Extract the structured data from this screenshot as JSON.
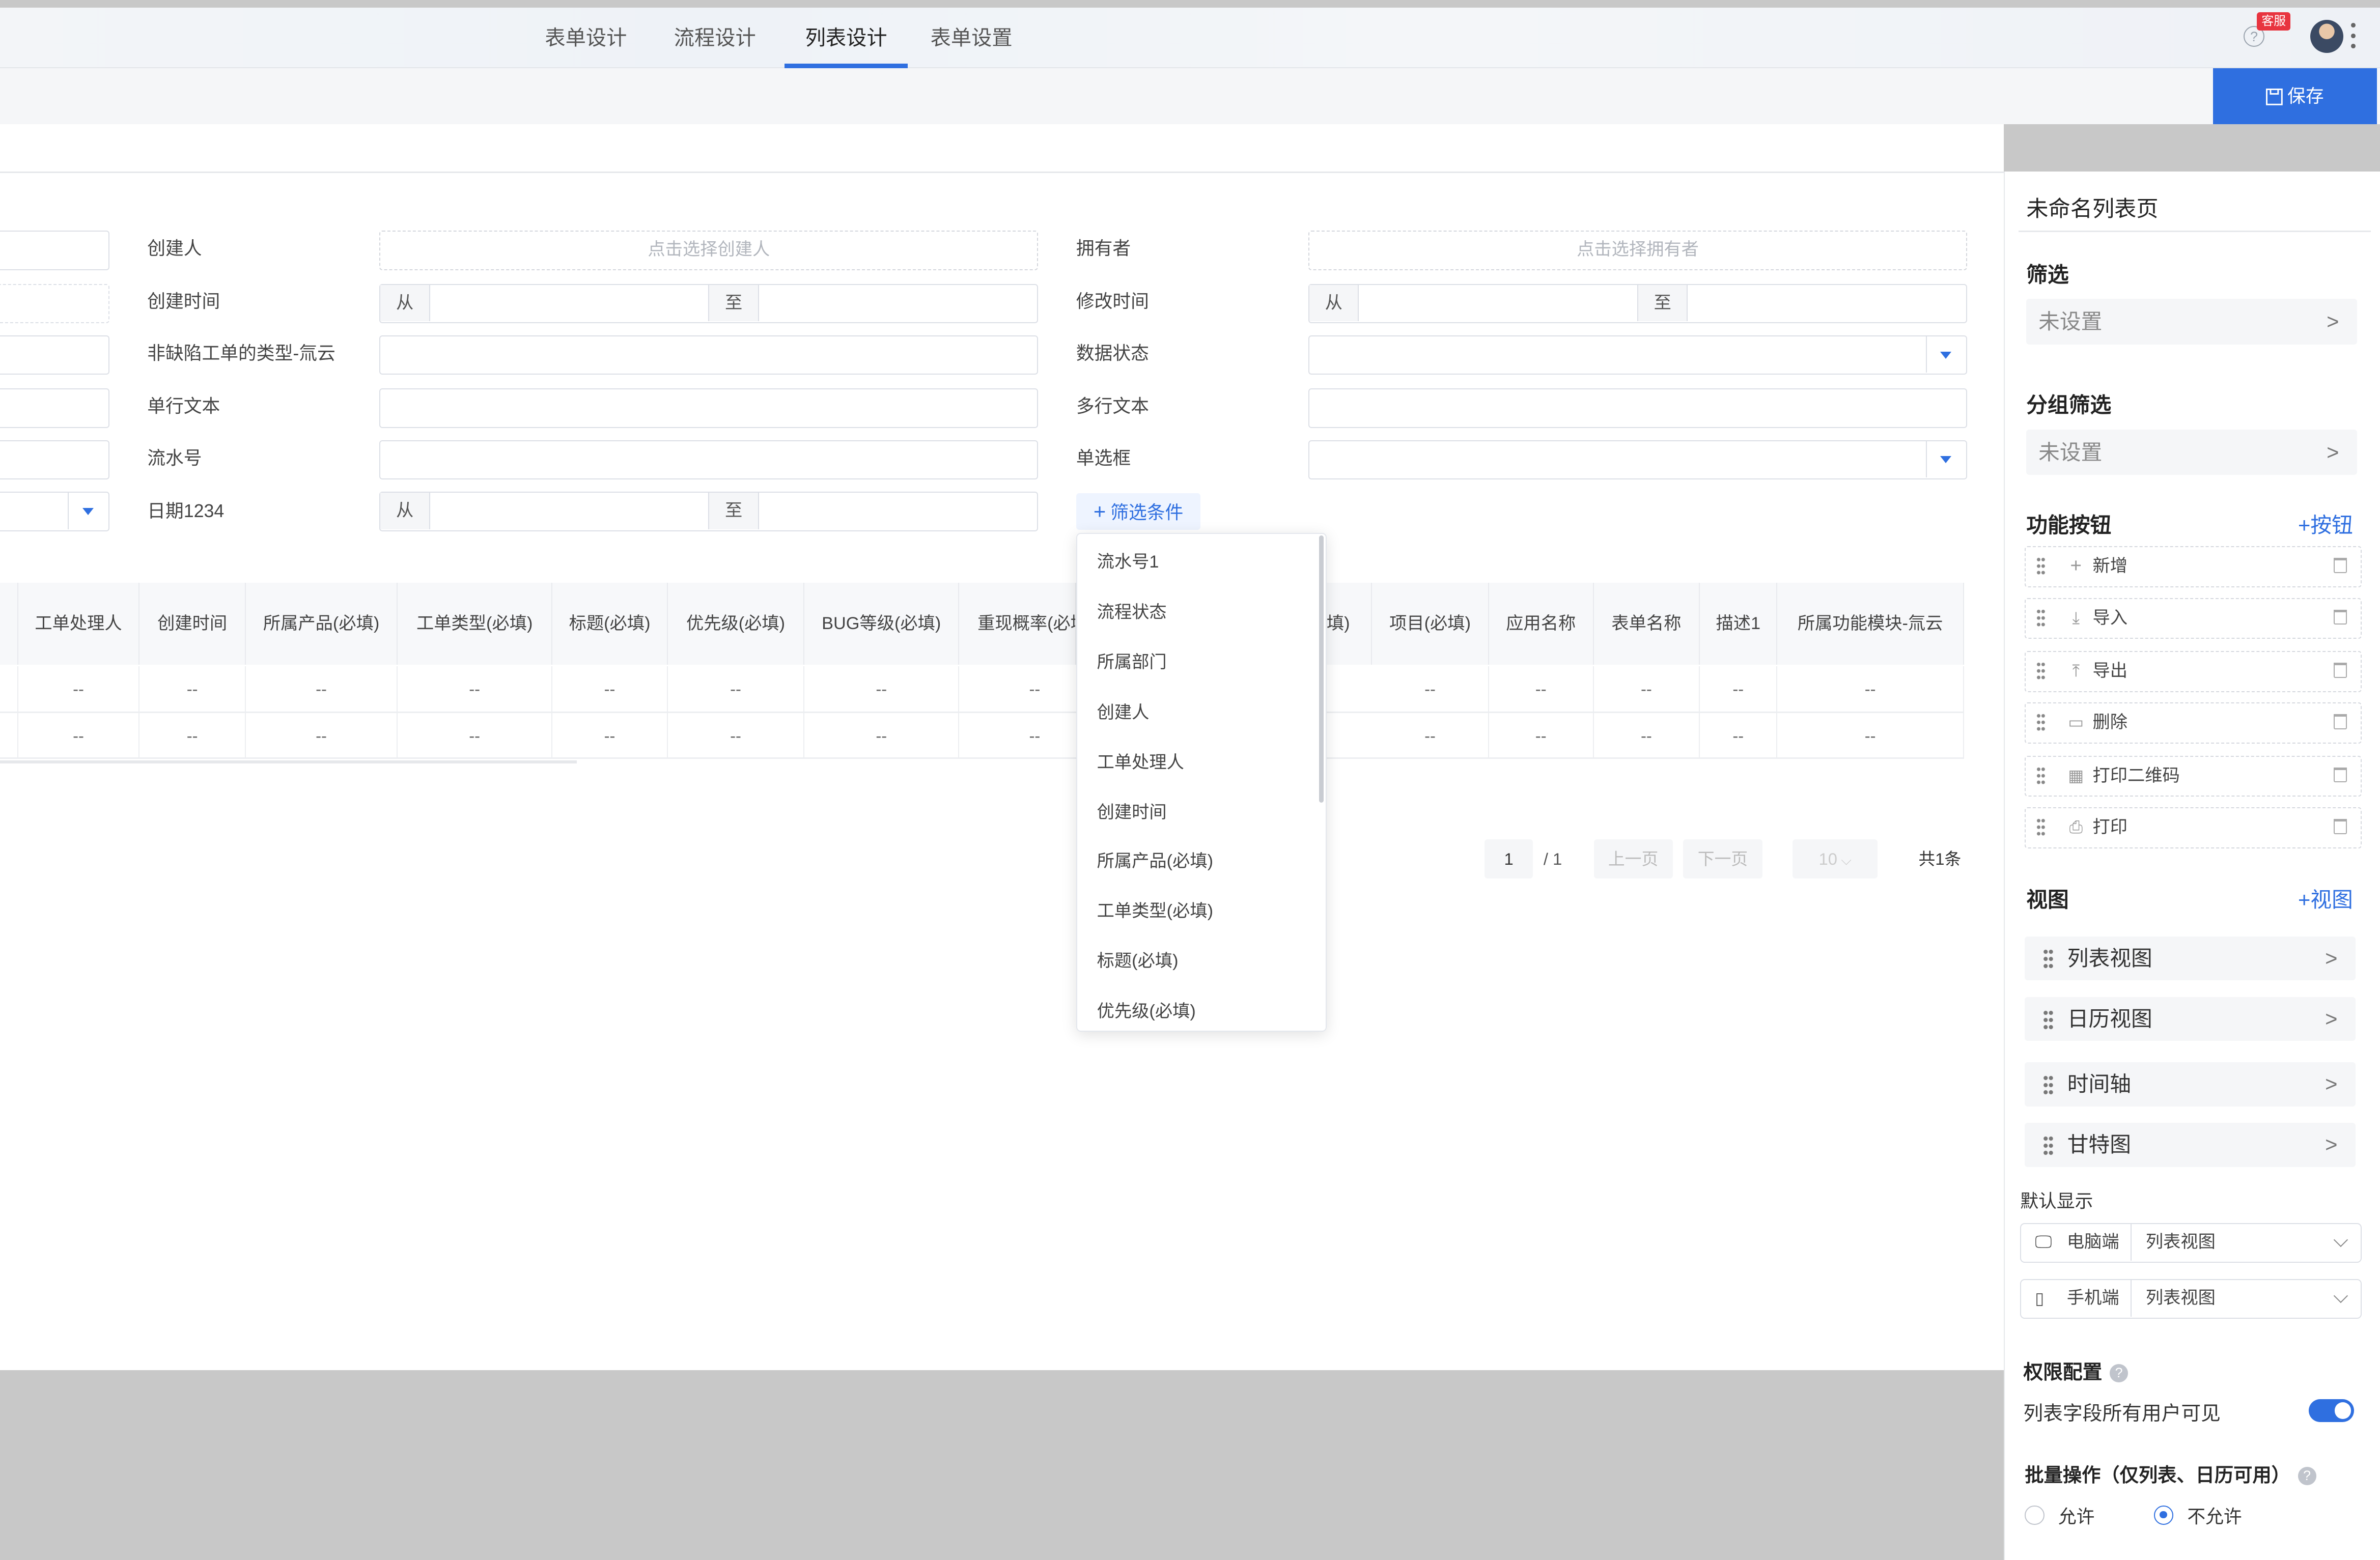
{
  "tabs": [
    {
      "label": "表单设计",
      "active": false
    },
    {
      "label": "流程设计",
      "active": false
    },
    {
      "label": "列表设计",
      "active": true
    },
    {
      "label": "表单设置",
      "active": false
    }
  ],
  "header": {
    "badge": "客服",
    "help_icon": "?"
  },
  "toolbar": {
    "save_label": "保存"
  },
  "filters": {
    "creator_label": "创建人",
    "creator_placeholder": "点击选择创建人",
    "owner_label": "拥有者",
    "owner_placeholder": "点击选择拥有者",
    "created_time_label": "创建时间",
    "modified_time_label": "修改时间",
    "range_from": "从",
    "range_to": "至",
    "non_defect_label": "非缺陷工单的类型-氚云",
    "data_status_label": "数据状态",
    "single_text_label": "单行文本",
    "multi_text_label": "多行文本",
    "serial_label": "流水号",
    "radio_label": "单选框",
    "date_label": "日期1234",
    "add_filter_label": "筛选条件"
  },
  "table": {
    "headers": [
      "工单处理人",
      "创建时间",
      "所属产品(必填)",
      "工单类型(必填)",
      "标题(必填)",
      "优先级(必填)",
      "BUG等级(必填)",
      "重现概率(必填",
      "填)",
      "项目(必填)",
      "应用名称",
      "表单名称",
      "描述1",
      "所属功能模块-氚云"
    ],
    "rows": [
      [
        "--",
        "--",
        "--",
        "--",
        "--",
        "--",
        "--",
        "--",
        "--",
        "--",
        "--",
        "--",
        "--"
      ],
      [
        "--",
        "--",
        "--",
        "--",
        "--",
        "--",
        "--",
        "--",
        "--",
        "--",
        "--",
        "--",
        "--"
      ]
    ]
  },
  "pagination": {
    "current": "1",
    "total_pages": "/ 1",
    "prev": "上一页",
    "next": "下一页",
    "page_size": "10",
    "total": "共1条"
  },
  "dropdown": {
    "items": [
      "流水号1",
      "流程状态",
      "所属部门",
      "创建人",
      "工单处理人",
      "创建时间",
      "所属产品(必填)",
      "工单类型(必填)",
      "标题(必填)",
      "优先级(必填)"
    ]
  },
  "panel": {
    "title": "未命名列表页",
    "filter_title": "筛选",
    "filter_value": "未设置",
    "group_filter_title": "分组筛选",
    "group_filter_value": "未设置",
    "buttons_title": "功能按钮",
    "add_button": "+按钮",
    "buttons": [
      {
        "label": "新增",
        "icon": "plus-icon"
      },
      {
        "label": "导入",
        "icon": "import-icon"
      },
      {
        "label": "导出",
        "icon": "export-icon"
      },
      {
        "label": "删除",
        "icon": "trash-icon"
      },
      {
        "label": "打印二维码",
        "icon": "qrcode-icon"
      },
      {
        "label": "打印",
        "icon": "printer-icon"
      }
    ],
    "views_title": "视图",
    "add_view": "+视图",
    "views": [
      "列表视图",
      "日历视图",
      "时间轴",
      "甘特图"
    ],
    "default_display_title": "默认显示",
    "pc_label": "电脑端",
    "pc_value": "列表视图",
    "mobile_label": "手机端",
    "mobile_value": "列表视图",
    "permission_title": "权限配置",
    "permission_toggle_label": "列表字段所有用户可见",
    "permission_toggle_on": true,
    "batch_title": "批量操作（仅列表、日历可用）",
    "batch_allow": "允许",
    "batch_disallow": "不允许",
    "batch_selected": "不允许"
  },
  "colors": {
    "accent": "#2f6fe0",
    "badge": "#e8343f"
  }
}
